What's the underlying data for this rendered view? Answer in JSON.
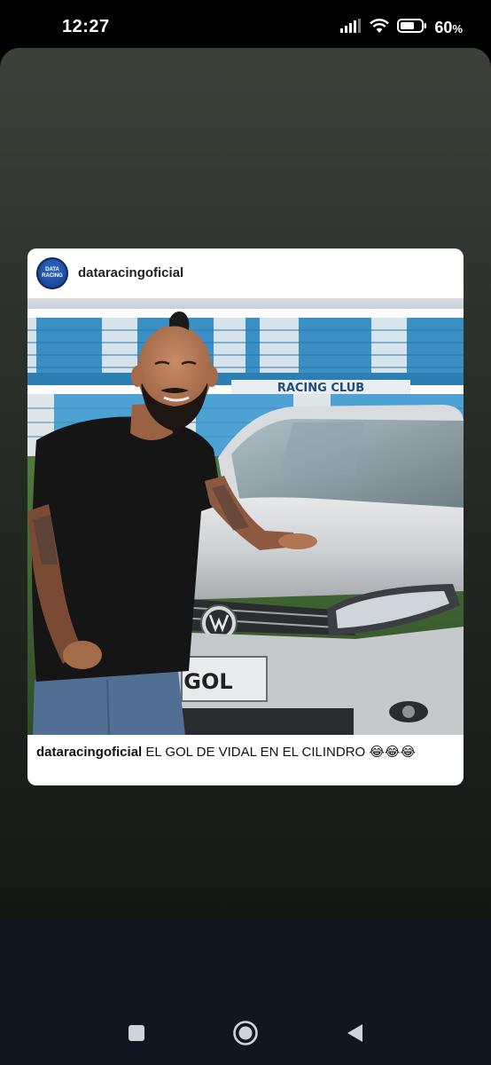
{
  "status_bar": {
    "time": "12:27",
    "battery_percent": "60",
    "battery_unit": "%"
  },
  "post": {
    "username": "dataracingoficial",
    "avatar_text_line1": "DATA",
    "avatar_text_line2": "RACING",
    "photo": {
      "stadium_sign": "RACING CLUB",
      "plate_text": "GOL"
    },
    "caption": {
      "username": "dataracingoficial",
      "text": "EL GOL DE VIDAL EN EL CILINDRO",
      "emojis": "😂😂😂"
    }
  },
  "nav_bar": {
    "icons": [
      "recents-square-icon",
      "home-circle-icon",
      "back-triangle-icon"
    ]
  },
  "colors": {
    "accent_blue": "#1d4a9a",
    "nav_background": "#121620",
    "story_background_top": "#3b4139"
  }
}
